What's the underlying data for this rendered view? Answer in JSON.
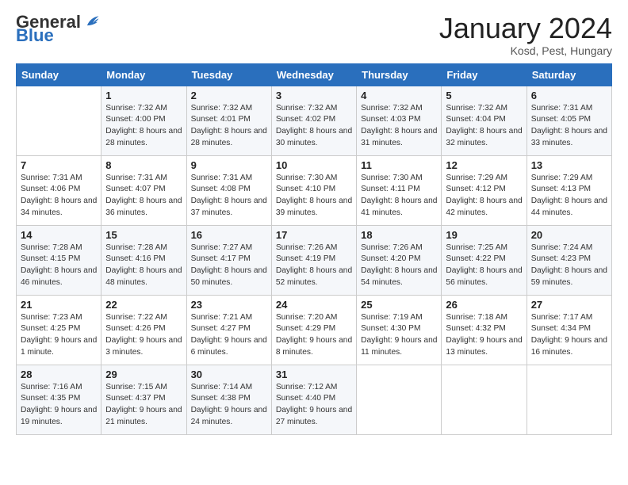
{
  "header": {
    "logo_general": "General",
    "logo_blue": "Blue",
    "month_title": "January 2024",
    "location": "Kosd, Pest, Hungary"
  },
  "days_of_week": [
    "Sunday",
    "Monday",
    "Tuesday",
    "Wednesday",
    "Thursday",
    "Friday",
    "Saturday"
  ],
  "weeks": [
    [
      {
        "day": "",
        "sunrise": "",
        "sunset": "",
        "daylight": ""
      },
      {
        "day": "1",
        "sunrise": "Sunrise: 7:32 AM",
        "sunset": "Sunset: 4:00 PM",
        "daylight": "Daylight: 8 hours and 28 minutes."
      },
      {
        "day": "2",
        "sunrise": "Sunrise: 7:32 AM",
        "sunset": "Sunset: 4:01 PM",
        "daylight": "Daylight: 8 hours and 28 minutes."
      },
      {
        "day": "3",
        "sunrise": "Sunrise: 7:32 AM",
        "sunset": "Sunset: 4:02 PM",
        "daylight": "Daylight: 8 hours and 30 minutes."
      },
      {
        "day": "4",
        "sunrise": "Sunrise: 7:32 AM",
        "sunset": "Sunset: 4:03 PM",
        "daylight": "Daylight: 8 hours and 31 minutes."
      },
      {
        "day": "5",
        "sunrise": "Sunrise: 7:32 AM",
        "sunset": "Sunset: 4:04 PM",
        "daylight": "Daylight: 8 hours and 32 minutes."
      },
      {
        "day": "6",
        "sunrise": "Sunrise: 7:31 AM",
        "sunset": "Sunset: 4:05 PM",
        "daylight": "Daylight: 8 hours and 33 minutes."
      }
    ],
    [
      {
        "day": "7",
        "sunrise": "Sunrise: 7:31 AM",
        "sunset": "Sunset: 4:06 PM",
        "daylight": "Daylight: 8 hours and 34 minutes."
      },
      {
        "day": "8",
        "sunrise": "Sunrise: 7:31 AM",
        "sunset": "Sunset: 4:07 PM",
        "daylight": "Daylight: 8 hours and 36 minutes."
      },
      {
        "day": "9",
        "sunrise": "Sunrise: 7:31 AM",
        "sunset": "Sunset: 4:08 PM",
        "daylight": "Daylight: 8 hours and 37 minutes."
      },
      {
        "day": "10",
        "sunrise": "Sunrise: 7:30 AM",
        "sunset": "Sunset: 4:10 PM",
        "daylight": "Daylight: 8 hours and 39 minutes."
      },
      {
        "day": "11",
        "sunrise": "Sunrise: 7:30 AM",
        "sunset": "Sunset: 4:11 PM",
        "daylight": "Daylight: 8 hours and 41 minutes."
      },
      {
        "day": "12",
        "sunrise": "Sunrise: 7:29 AM",
        "sunset": "Sunset: 4:12 PM",
        "daylight": "Daylight: 8 hours and 42 minutes."
      },
      {
        "day": "13",
        "sunrise": "Sunrise: 7:29 AM",
        "sunset": "Sunset: 4:13 PM",
        "daylight": "Daylight: 8 hours and 44 minutes."
      }
    ],
    [
      {
        "day": "14",
        "sunrise": "Sunrise: 7:28 AM",
        "sunset": "Sunset: 4:15 PM",
        "daylight": "Daylight: 8 hours and 46 minutes."
      },
      {
        "day": "15",
        "sunrise": "Sunrise: 7:28 AM",
        "sunset": "Sunset: 4:16 PM",
        "daylight": "Daylight: 8 hours and 48 minutes."
      },
      {
        "day": "16",
        "sunrise": "Sunrise: 7:27 AM",
        "sunset": "Sunset: 4:17 PM",
        "daylight": "Daylight: 8 hours and 50 minutes."
      },
      {
        "day": "17",
        "sunrise": "Sunrise: 7:26 AM",
        "sunset": "Sunset: 4:19 PM",
        "daylight": "Daylight: 8 hours and 52 minutes."
      },
      {
        "day": "18",
        "sunrise": "Sunrise: 7:26 AM",
        "sunset": "Sunset: 4:20 PM",
        "daylight": "Daylight: 8 hours and 54 minutes."
      },
      {
        "day": "19",
        "sunrise": "Sunrise: 7:25 AM",
        "sunset": "Sunset: 4:22 PM",
        "daylight": "Daylight: 8 hours and 56 minutes."
      },
      {
        "day": "20",
        "sunrise": "Sunrise: 7:24 AM",
        "sunset": "Sunset: 4:23 PM",
        "daylight": "Daylight: 8 hours and 59 minutes."
      }
    ],
    [
      {
        "day": "21",
        "sunrise": "Sunrise: 7:23 AM",
        "sunset": "Sunset: 4:25 PM",
        "daylight": "Daylight: 9 hours and 1 minute."
      },
      {
        "day": "22",
        "sunrise": "Sunrise: 7:22 AM",
        "sunset": "Sunset: 4:26 PM",
        "daylight": "Daylight: 9 hours and 3 minutes."
      },
      {
        "day": "23",
        "sunrise": "Sunrise: 7:21 AM",
        "sunset": "Sunset: 4:27 PM",
        "daylight": "Daylight: 9 hours and 6 minutes."
      },
      {
        "day": "24",
        "sunrise": "Sunrise: 7:20 AM",
        "sunset": "Sunset: 4:29 PM",
        "daylight": "Daylight: 9 hours and 8 minutes."
      },
      {
        "day": "25",
        "sunrise": "Sunrise: 7:19 AM",
        "sunset": "Sunset: 4:30 PM",
        "daylight": "Daylight: 9 hours and 11 minutes."
      },
      {
        "day": "26",
        "sunrise": "Sunrise: 7:18 AM",
        "sunset": "Sunset: 4:32 PM",
        "daylight": "Daylight: 9 hours and 13 minutes."
      },
      {
        "day": "27",
        "sunrise": "Sunrise: 7:17 AM",
        "sunset": "Sunset: 4:34 PM",
        "daylight": "Daylight: 9 hours and 16 minutes."
      }
    ],
    [
      {
        "day": "28",
        "sunrise": "Sunrise: 7:16 AM",
        "sunset": "Sunset: 4:35 PM",
        "daylight": "Daylight: 9 hours and 19 minutes."
      },
      {
        "day": "29",
        "sunrise": "Sunrise: 7:15 AM",
        "sunset": "Sunset: 4:37 PM",
        "daylight": "Daylight: 9 hours and 21 minutes."
      },
      {
        "day": "30",
        "sunrise": "Sunrise: 7:14 AM",
        "sunset": "Sunset: 4:38 PM",
        "daylight": "Daylight: 9 hours and 24 minutes."
      },
      {
        "day": "31",
        "sunrise": "Sunrise: 7:12 AM",
        "sunset": "Sunset: 4:40 PM",
        "daylight": "Daylight: 9 hours and 27 minutes."
      },
      {
        "day": "",
        "sunrise": "",
        "sunset": "",
        "daylight": ""
      },
      {
        "day": "",
        "sunrise": "",
        "sunset": "",
        "daylight": ""
      },
      {
        "day": "",
        "sunrise": "",
        "sunset": "",
        "daylight": ""
      }
    ]
  ]
}
